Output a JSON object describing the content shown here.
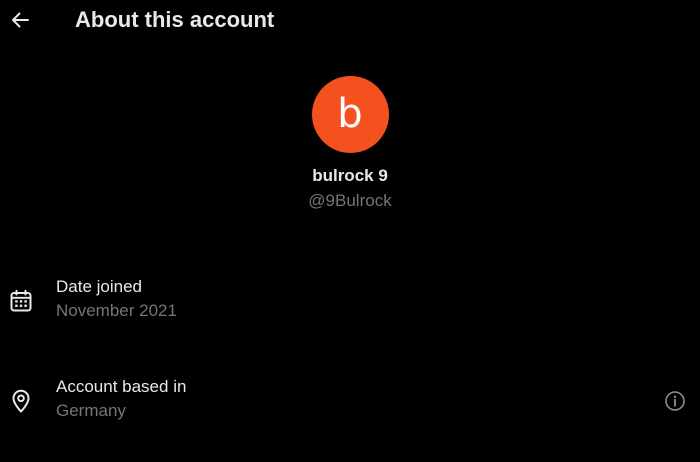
{
  "header": {
    "back_icon": "arrow-left-icon",
    "title": "About this account"
  },
  "profile": {
    "avatar_letter": "b",
    "avatar_color": "#f4511e",
    "display_name": "bulrock 9",
    "handle": "@9Bulrock"
  },
  "details": {
    "date_joined": {
      "icon": "calendar-icon",
      "label": "Date joined",
      "value": "November 2021"
    },
    "based_in": {
      "icon": "location-pin-icon",
      "label": "Account based in",
      "value": "Germany",
      "info_icon": "info-icon"
    }
  },
  "colors": {
    "background": "#000000",
    "primary_text": "#e7e9ea",
    "secondary_text": "#71767b"
  }
}
